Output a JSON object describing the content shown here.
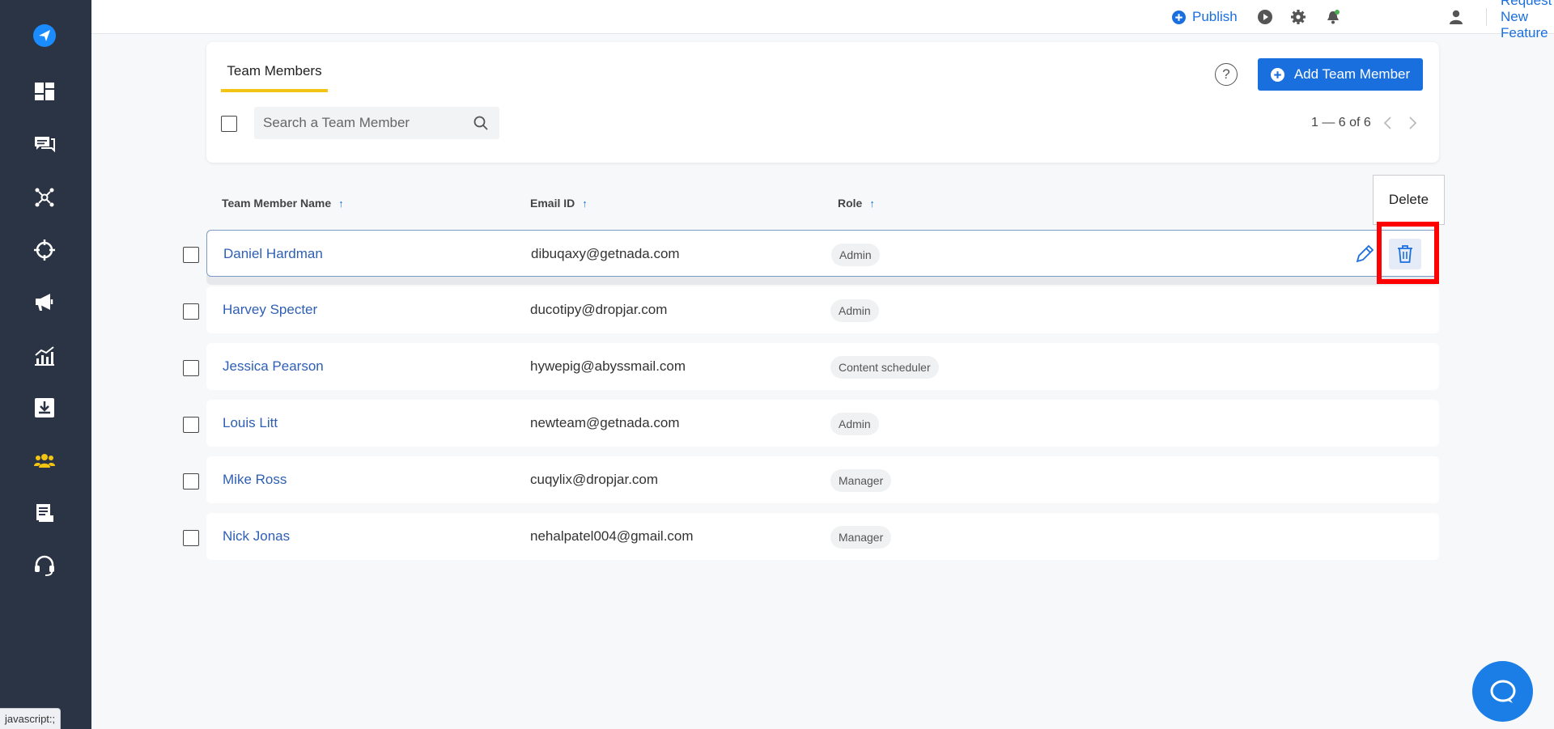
{
  "topbar": {
    "publish_label": "Publish",
    "request_label": "Request New Feature",
    "icons": [
      "play-icon",
      "gear-icon",
      "notification-bell-icon",
      "user-icon"
    ]
  },
  "sidebar": {
    "items": [
      "logo-icon",
      "dashboard-icon",
      "messages-icon",
      "network-icon",
      "target-icon",
      "megaphone-icon",
      "analytics-icon",
      "download-icon",
      "team-icon",
      "reports-icon",
      "support-icon"
    ]
  },
  "header": {
    "tab_label": "Team Members",
    "help_label": "?",
    "add_button_label": "Add Team Member",
    "search_placeholder": "Search a Team Member",
    "pagination": "1 — 6 of 6"
  },
  "table": {
    "columns": [
      "Team Member Name",
      "Email ID",
      "Role"
    ],
    "sort_arrow": "↑",
    "rows": [
      {
        "name": "Daniel Hardman",
        "email": "dibuqaxy@getnada.com",
        "role": "Admin"
      },
      {
        "name": "Harvey Specter",
        "email": "ducotipy@dropjar.com",
        "role": "Admin"
      },
      {
        "name": "Jessica Pearson",
        "email": "hywepig@abyssmail.com",
        "role": "Content scheduler"
      },
      {
        "name": "Louis Litt",
        "email": "newteam@getnada.com",
        "role": "Admin"
      },
      {
        "name": "Mike Ross",
        "email": "cuqylix@dropjar.com",
        "role": "Manager"
      },
      {
        "name": "Nick Jonas",
        "email": "nehalpatel004@gmail.com",
        "role": "Manager"
      }
    ]
  },
  "tooltip": {
    "label": "Delete"
  },
  "statusbar": {
    "text": "javascript:;"
  },
  "colors": {
    "accent": "#1a6fdf",
    "sidebar": "#2b3445",
    "tab_underline": "#f2c513",
    "highlight": "#ff0000",
    "team_icon": "#f2c513"
  }
}
